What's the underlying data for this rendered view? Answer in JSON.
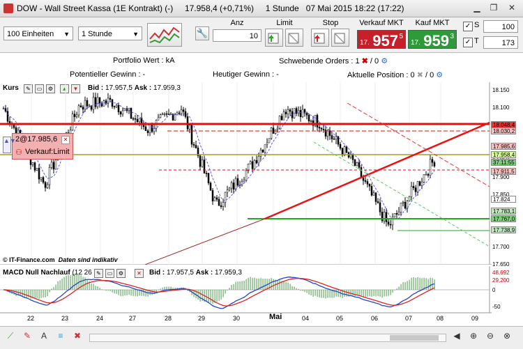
{
  "window": {
    "title": "DOW - Wall Street Kassa (1E Kontrakt) (-)",
    "price": "17.958,4 (+0,71%)",
    "interval": "1 Stunde",
    "datetime": "07 Mai 2015 18:22 (17:22)"
  },
  "toolbar": {
    "units": "100 Einheiten",
    "timeframe": "1 Stunde",
    "anz_label": "Anz",
    "anz_value": "10",
    "limit_label": "Limit",
    "stop_label": "Stop",
    "sell_label": "Verkauf MKT",
    "sell_prefix": "17.",
    "sell_main": "957",
    "sell_sup": "5",
    "buy_label": "Kauf MKT",
    "buy_prefix": "17.",
    "buy_main": "959",
    "buy_sup": "3",
    "s_label": "S",
    "s_value": "100",
    "t_label": "T",
    "t_value": "173"
  },
  "info": {
    "portfolio": "Portfolio Wert : kA",
    "pending_label": "Schwebende Orders : 1",
    "pending_tail": "/ 0",
    "potential": "Potentieller Gewinn : -",
    "today": "Heutiger Gewinn : -",
    "position_label": "Aktuelle Position : 0",
    "position_tail": "/ 0"
  },
  "price_panel": {
    "name": "Kurs",
    "bid_label": "Bid :",
    "bid": "17.957,5",
    "ask_label": "Ask :",
    "ask": "17.959,3",
    "order_price": "2@17.985,6",
    "order_type": "Verkauf:Limit",
    "watermark": "© IT-Finance.com",
    "disclaimer": "Daten sind indikativ",
    "y_ticks": [
      "18.150",
      "18.100",
      "18.050",
      "17.950",
      "17.900",
      "17.850",
      "17.800",
      "17.750",
      "17.700",
      "17.650"
    ],
    "tags": [
      {
        "text": "18.048,4",
        "color": "#e33"
      },
      {
        "text": "18.030,2",
        "color": "#f9c0c0"
      },
      {
        "text": "17.985,6",
        "color": "#f9c0c0"
      },
      {
        "text": "17.958,4",
        "color": "#d8ff9a"
      },
      {
        "text": "37.11:55",
        "color": "#7fcf7f"
      },
      {
        "text": "17.911,5",
        "color": "#f9c0c0"
      },
      {
        "text": "17.824",
        "color": "#fff"
      },
      {
        "text": "17.783,1",
        "color": "#bfe6bf"
      },
      {
        "text": "17.767,0",
        "color": "#7fcf7f"
      },
      {
        "text": "17.738,9",
        "color": "#bfe6bf"
      }
    ]
  },
  "macd_panel": {
    "name": "MACD Null Nachlauf",
    "params": "(12 26 9)",
    "bid_label": "Bid :",
    "bid": "17.957,5",
    "ask_label": "Ask :",
    "ask": "17.959,3",
    "tag_top": "48,692",
    "tag_mid": "29,200",
    "zero": "0",
    "minus": "-50"
  },
  "x_axis": [
    "22",
    "23",
    "24",
    "27",
    "28",
    "29",
    "30",
    "Mai",
    "04",
    "05",
    "06",
    "07",
    "08",
    "09"
  ],
  "chart_data": {
    "type": "line",
    "title": "Kurs",
    "xlabel": "",
    "ylabel": "",
    "x": [
      "22",
      "23",
      "24",
      "27",
      "28",
      "29",
      "30",
      "Mai",
      "04",
      "05",
      "06",
      "07",
      "08"
    ],
    "ylim": [
      17650,
      18175
    ],
    "series": [
      {
        "values": [
          18100,
          17880,
          18110,
          18120,
          18040,
          18100,
          17820,
          17940,
          18100,
          18060,
          17940,
          17760,
          17958
        ]
      }
    ],
    "levels": [
      18048.4,
      18030.2,
      17985.6,
      17958.4,
      17911.5,
      17824,
      17783.1,
      17767.0,
      17738.9
    ]
  },
  "colors": {
    "sell": "#c8202a",
    "buy": "#2e9a3a",
    "support": "#22aa22",
    "resistance": "#dd1111"
  }
}
